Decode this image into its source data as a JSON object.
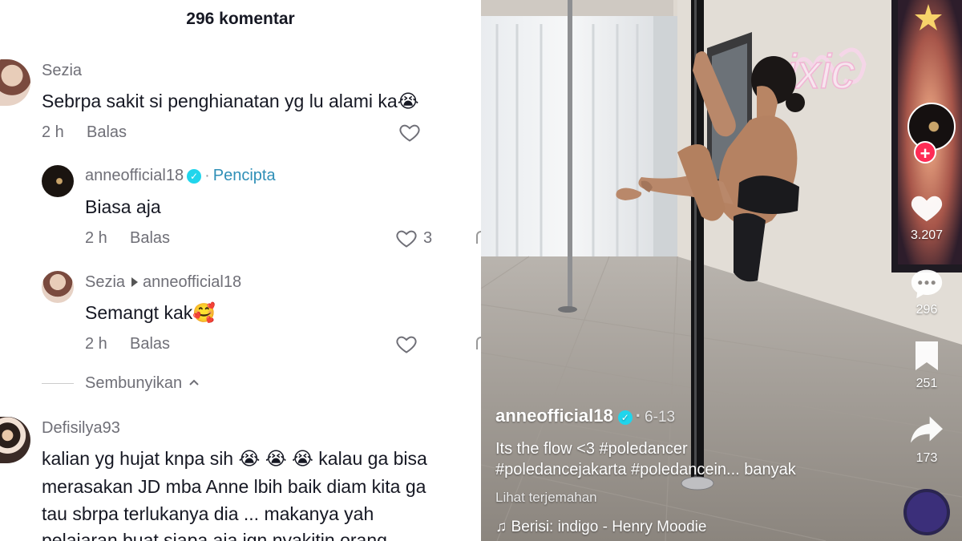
{
  "comments_panel": {
    "title": "296 komentar",
    "comments": [
      {
        "username": "Sezia",
        "text": "Sebrpa sakit si penghianatan yg lu alami ka😭",
        "time": "2 h",
        "reply_label": "Balas"
      },
      {
        "username": "anneofficial18",
        "badge": "✓",
        "creator_label": "Pencipta",
        "text": "Biasa aja",
        "time": "2 h",
        "reply_label": "Balas",
        "likes": "3"
      },
      {
        "username": "Sezia",
        "reply_to": "anneofficial18",
        "text": "Semangt kak🥰",
        "time": "2 h",
        "reply_label": "Balas"
      },
      {
        "username": "Defisilya93",
        "lines": [
          "kalian yg hujat knpa sih 😭 😭 😭  kalau ga bisa",
          "merasakan JD mba Anne lbih baik diam kita ga",
          "tau sbrpa terlukanya dia ... makanya yah",
          "pelajaran buat siapa aja jgn nyakitin orang"
        ]
      }
    ],
    "hide_replies_label": "Sembunyikan",
    "hide_chevron": "^"
  },
  "video": {
    "username": "anneofficial18",
    "badge": "✓",
    "date": "6-13",
    "caption_line1": "Its the flow <3 #poledancer",
    "caption_line2": "#poledancejakarta #poledancein... banyak",
    "translate_label": "Lihat terjemahan",
    "music_icon": "♫",
    "music": "Berisi: indigo - Henry Moodie",
    "sign_text": "ixic",
    "rail": {
      "follow_plus": "+",
      "likes": "3.207",
      "comments": "296",
      "saves": "251",
      "shares": "173"
    }
  },
  "colors": {
    "text_primary": "#161823",
    "text_secondary": "#6f6f77",
    "creator_blue": "#2f8fb7",
    "verified": "#20d5ec",
    "tiktok_red": "#fe2c55"
  },
  "icons": [
    "heart-outline-icon",
    "verified-icon",
    "chevron-up-icon",
    "heart-icon",
    "comment-icon",
    "bookmark-icon",
    "share-icon",
    "music-note-icon",
    "music-disc-icon"
  ]
}
